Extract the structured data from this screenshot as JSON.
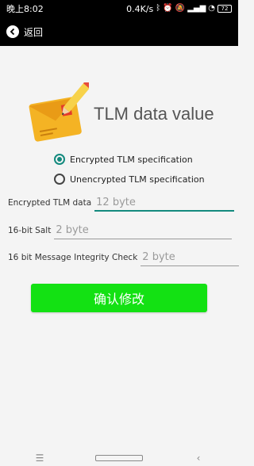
{
  "status_bar": {
    "time": "晚上8:02",
    "speed": "0.4K/s",
    "battery": "72",
    "icons": [
      "bluetooth-icon",
      "alarm-icon",
      "mute-icon",
      "signal-icon",
      "wifi-icon",
      "battery-icon"
    ]
  },
  "header": {
    "back_label": "返回"
  },
  "hero": {
    "title": "TLM data value",
    "icon": "envelope-pencil-icon"
  },
  "options": {
    "encrypted_label": "Encrypted TLM specification",
    "unencrypted_label": "Unencrypted TLM specification",
    "selected": "encrypted"
  },
  "fields": {
    "tlm_data_label": "Encrypted TLM data",
    "tlm_data_placeholder": "12 byte",
    "salt_label": "16-bit Salt",
    "salt_placeholder": "2 byte",
    "mic_label": "16 bit Message Integrity Check",
    "mic_placeholder": "2 byte"
  },
  "actions": {
    "confirm_label": "确认修改"
  },
  "nav": {
    "menu_glyph": "☰",
    "back_glyph": "‹"
  },
  "colors": {
    "accent": "#138a7e",
    "confirm_button": "#13e113",
    "background": "#f4f4f4",
    "status_bar": "#000000"
  }
}
